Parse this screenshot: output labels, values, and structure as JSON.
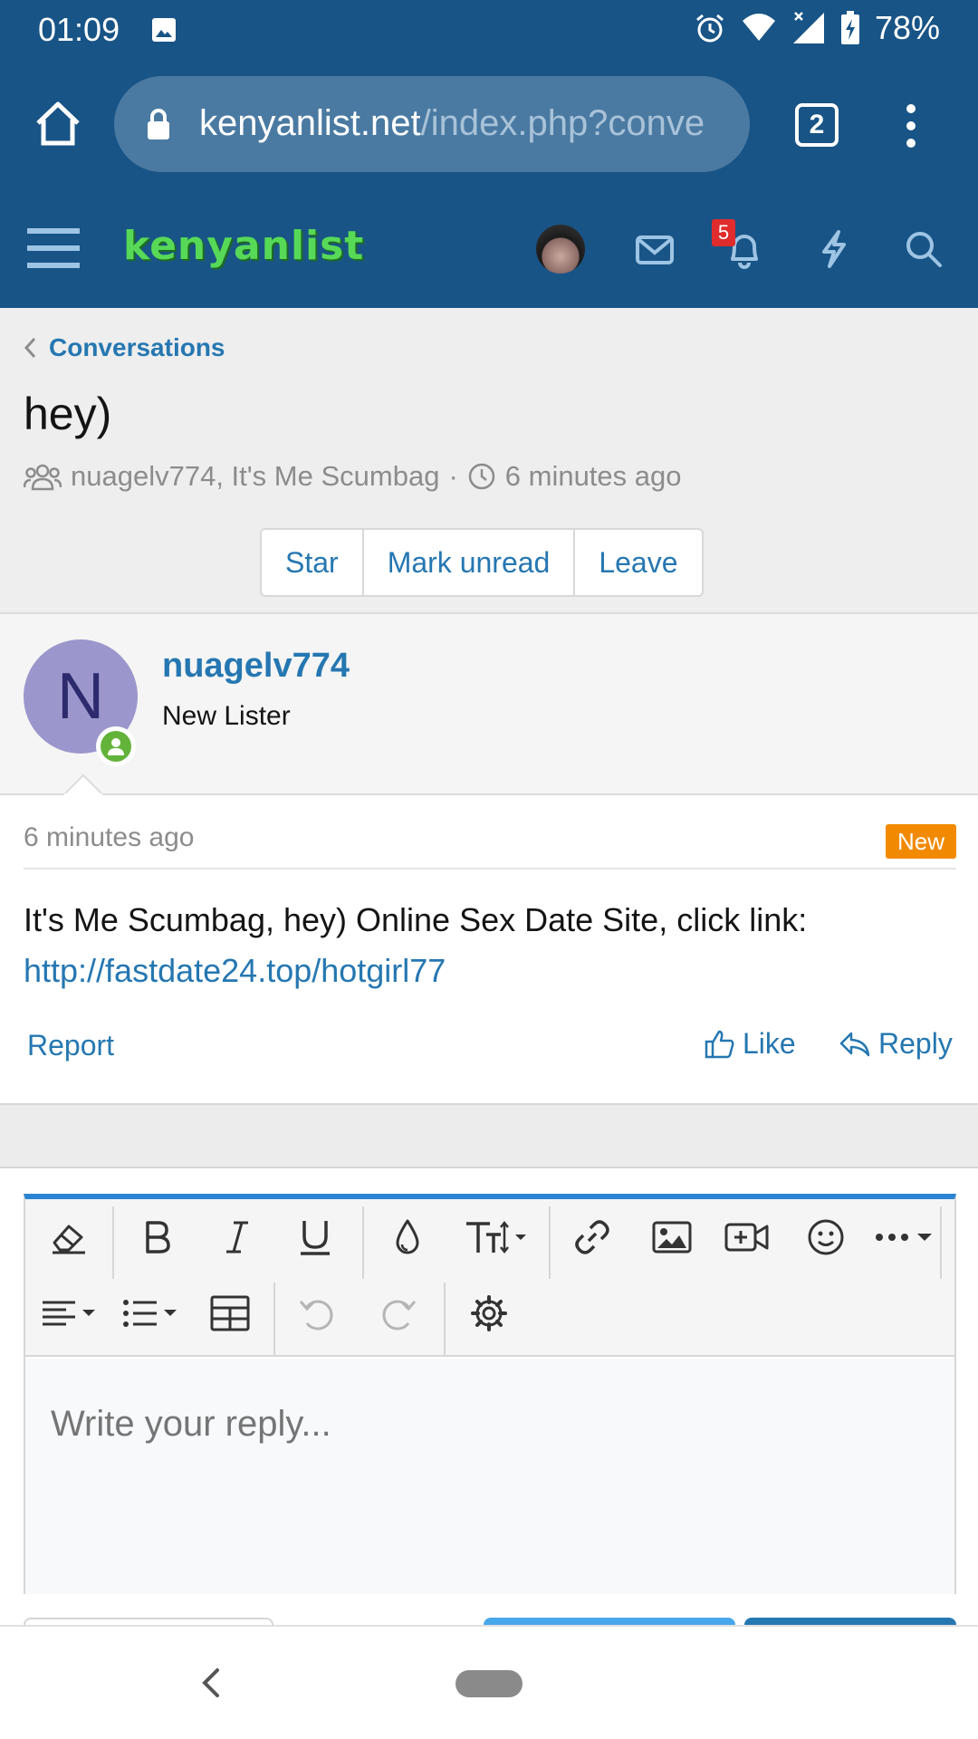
{
  "status_bar": {
    "time": "01:09",
    "battery": "78%"
  },
  "browser": {
    "url_host": "kenyanlist.net",
    "url_path": "/index.php?conve",
    "tab_count": "2"
  },
  "site": {
    "logo_text": "kenyanlist",
    "notification_count": "5"
  },
  "breadcrumb": {
    "label": "Conversations"
  },
  "conversation": {
    "title": "hey)",
    "participants": "nuagelv774, It's Me Scumbag",
    "separator": "·",
    "time": "6 minutes ago",
    "actions": [
      "Star",
      "Mark unread",
      "Leave"
    ]
  },
  "message": {
    "avatar_letter": "N",
    "username": "nuagelv774",
    "user_title": "New Lister",
    "time": "6 minutes ago",
    "badge": "New",
    "text": "It's Me Scumbag, hey) Online Sex Date Site, click link:",
    "link": "http://fastdate24.top/hotgirl77",
    "report": "Report",
    "like": "Like",
    "reply": "Reply"
  },
  "editor": {
    "placeholder": "Write your reply..."
  },
  "colors": {
    "header": "#185486",
    "link": "#2577b1",
    "badge_new": "#f18a00",
    "editor_accent": "#2b84d1"
  }
}
